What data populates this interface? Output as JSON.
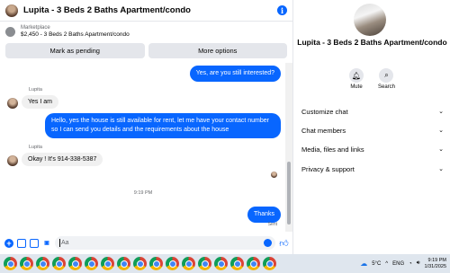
{
  "header": {
    "title": "Lupita - 3 Beds 2 Baths Apartment/condo",
    "info_icon": "info-icon"
  },
  "marketplace": {
    "label": "Marketplace",
    "listing": "$2,450 - 3 Beds 2 Baths Apartment/condo"
  },
  "actions": {
    "pending_label": "Mark as pending",
    "more_label": "More options"
  },
  "messages": {
    "m1": "Yes, are you still interested?",
    "sender1": "Lupita",
    "m2": "Yes I am",
    "m3": "Hello, yes the house is still available for rent, let me have your contact number so I can send you details and the requirements about the house",
    "sender2": "Lupita",
    "m4": "Okay ! It's 914-338-5387",
    "time": "9:19 PM",
    "m5": "Thanks",
    "status": "Sent"
  },
  "composer": {
    "placeholder": "Aa"
  },
  "details": {
    "title": "Lupita - 3 Beds 2 Baths Apartment/condo",
    "mute_label": "Mute",
    "search_label": "Search",
    "sections": [
      "Customize chat",
      "Chat members",
      "Media, files and links",
      "Privacy & support"
    ]
  },
  "taskbar": {
    "temperature": "5°C",
    "language": "ENG",
    "time": "9:19 PM",
    "date": "1/31/2025",
    "app_count": 17
  },
  "colors": {
    "accent": "#0866ff",
    "bubble_in": "#f0f0f0",
    "taskbar": "#dfe6ee"
  }
}
